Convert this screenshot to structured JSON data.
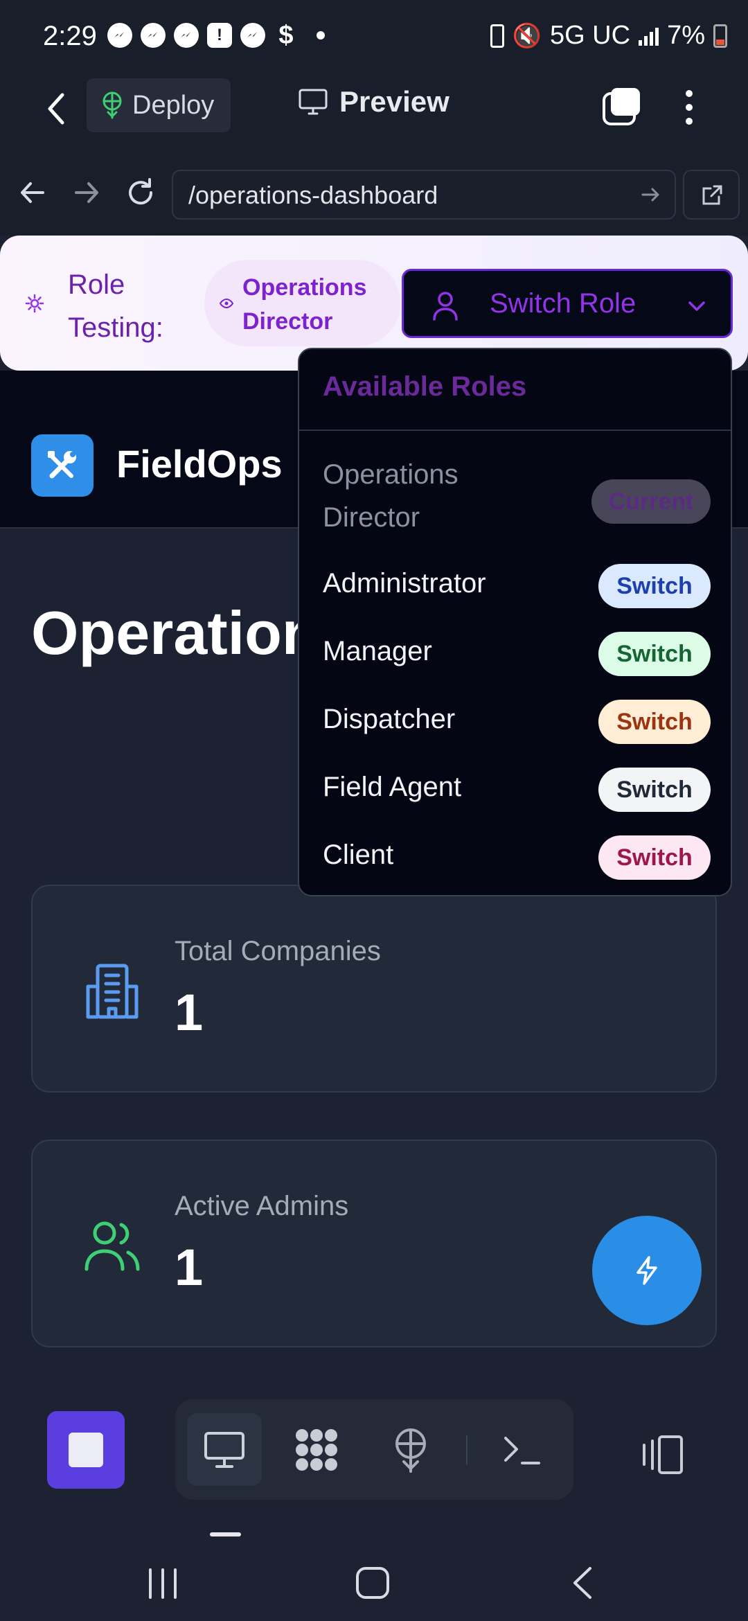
{
  "status_bar": {
    "time": "2:29",
    "network": "5G UC",
    "battery": "7%",
    "notification_icons": [
      "messenger-icon",
      "messenger-icon",
      "messenger-icon",
      "alert-icon",
      "messenger-icon",
      "dollar-icon"
    ]
  },
  "toolbar": {
    "deploy_label": "Deploy",
    "preview_label": "Preview"
  },
  "url_bar": {
    "url": "/operations-dashboard"
  },
  "role_bar": {
    "label": "Role Testing:",
    "current_role": "Operations Director",
    "switch_label": "Switch Role"
  },
  "app": {
    "name": "FieldOps",
    "logo_icon": "tools-icon",
    "accent": "#2f8ee8"
  },
  "page": {
    "title": "Operations Director Dashboard"
  },
  "stats": [
    {
      "label": "Total Companies",
      "value": "1",
      "icon": "building-icon",
      "color": "#5b9bf0"
    },
    {
      "label": "Active Admins",
      "value": "1",
      "icon": "users-icon",
      "color": "#3fcf75"
    }
  ],
  "dropdown": {
    "title": "Available Roles",
    "roles": [
      {
        "name": "Operations Director",
        "action": "Current",
        "current": true
      },
      {
        "name": "Administrator",
        "action": "Switch"
      },
      {
        "name": "Manager",
        "action": "Switch"
      },
      {
        "name": "Dispatcher",
        "action": "Switch"
      },
      {
        "name": "Field Agent",
        "action": "Switch"
      },
      {
        "name": "Client",
        "action": "Switch"
      }
    ],
    "badge_colors": {
      "current": {
        "bg": "#4a4659",
        "fg": "#5a2a85"
      },
      "administrator": {
        "bg": "#dbe9fe",
        "fg": "#1e40af"
      },
      "manager": {
        "bg": "#dcfce7",
        "fg": "#166534"
      },
      "dispatcher": {
        "bg": "#ffedd5",
        "fg": "#9a3412"
      },
      "field_agent": {
        "bg": "#f3f4f6",
        "fg": "#1f2937"
      },
      "client": {
        "bg": "#fce7f3",
        "fg": "#9d174d"
      }
    }
  },
  "dock": {
    "items": [
      "monitor-icon",
      "apps-icon",
      "deploy-icon",
      "terminal-icon"
    ],
    "active_item": "monitor-icon"
  },
  "fab": {
    "icon": "lightning-icon"
  }
}
